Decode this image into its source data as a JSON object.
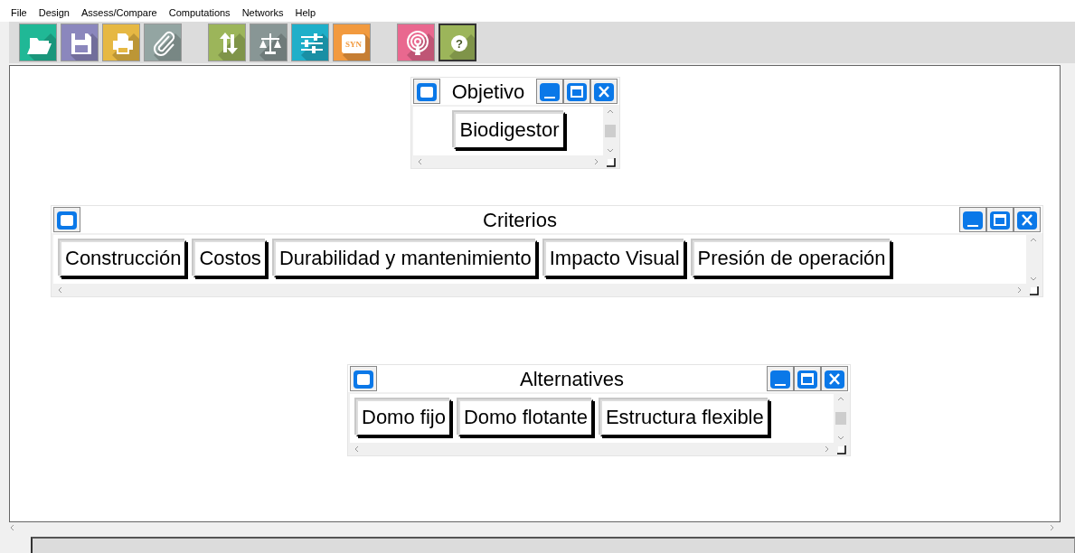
{
  "menu": [
    "File",
    "Design",
    "Assess/Compare",
    "Computations",
    "Networks",
    "Help"
  ],
  "toolbar": [
    {
      "kind": "open",
      "color": "#20b896",
      "pressed": false
    },
    {
      "kind": "save",
      "color": "#8b87bd",
      "pressed": false
    },
    {
      "kind": "print",
      "color": "#e6b843",
      "pressed": false
    },
    {
      "kind": "attach",
      "color": "#93a5a2",
      "pressed": false
    },
    {
      "kind": "sep"
    },
    {
      "kind": "sync",
      "color": "#9cb55a",
      "pressed": false
    },
    {
      "kind": "scale",
      "color": "#889695",
      "pressed": false
    },
    {
      "kind": "sliders",
      "color": "#1fafc9",
      "pressed": false
    },
    {
      "kind": "syn",
      "color": "#f29a3f",
      "label": "SYN",
      "pressed": false
    },
    {
      "kind": "sep"
    },
    {
      "kind": "signal",
      "color": "#e9688f",
      "pressed": false
    },
    {
      "kind": "help",
      "color": "#9cb55a",
      "label": "?",
      "pressed": true
    }
  ],
  "panels": [
    {
      "title": "Objetivo",
      "items": [
        "Biodigestor"
      ]
    },
    {
      "title": "Criterios",
      "items": [
        "Construcción",
        "Costos",
        "Durabilidad y mantenimiento",
        "Impacto Visual",
        "Presión de operación"
      ]
    },
    {
      "title": "Alternatives",
      "items": [
        "Domo fijo",
        "Domo flotante",
        "Estructura flexible"
      ]
    }
  ]
}
